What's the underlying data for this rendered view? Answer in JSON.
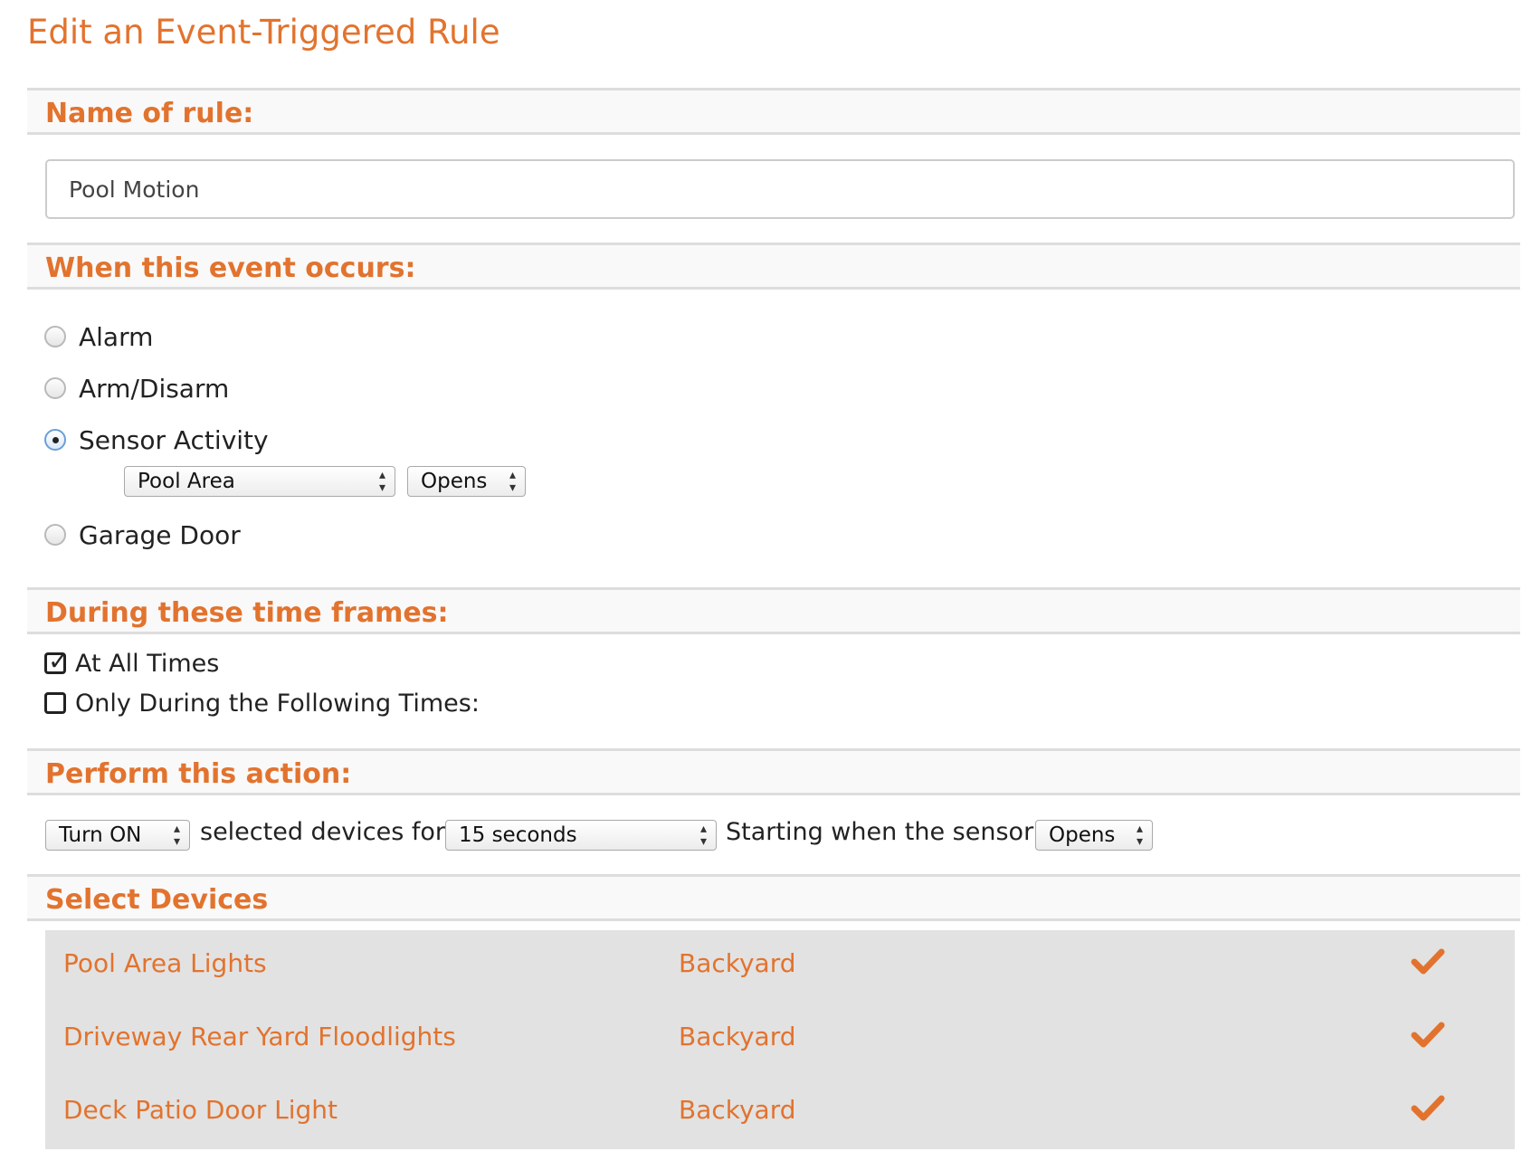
{
  "page": {
    "title": "Edit an Event-Triggered Rule"
  },
  "name_section": {
    "heading": "Name of rule:",
    "value": "Pool Motion"
  },
  "event_section": {
    "heading": "When this event occurs:",
    "options": [
      {
        "label": "Alarm",
        "selected": false
      },
      {
        "label": "Arm/Disarm",
        "selected": false
      },
      {
        "label": "Sensor Activity",
        "selected": true
      },
      {
        "label": "Garage Door",
        "selected": false
      }
    ],
    "sensor_select": "Pool Area",
    "sensor_state_select": "Opens"
  },
  "time_section": {
    "heading": "During these time frames:",
    "options": [
      {
        "label": "At All Times",
        "checked": true
      },
      {
        "label": "Only During the Following Times:",
        "checked": false
      }
    ]
  },
  "action_section": {
    "heading": "Perform this action:",
    "action_select": "Turn ON",
    "text_devices_for": "selected devices for",
    "duration_select": "15 seconds",
    "text_starting": "Starting when the sensor",
    "trigger_select": "Opens"
  },
  "devices_section": {
    "heading": "Select Devices",
    "devices": [
      {
        "name": "Pool Area Lights",
        "location": "Backyard",
        "selected": true
      },
      {
        "name": "Driveway Rear Yard Floodlights",
        "location": "Backyard",
        "selected": true
      },
      {
        "name": "Deck Patio Door Light",
        "location": "Backyard",
        "selected": true
      }
    ]
  },
  "colors": {
    "accent": "#e2732e",
    "section_border": "#dddddd",
    "device_bg": "#e2e2e2"
  }
}
